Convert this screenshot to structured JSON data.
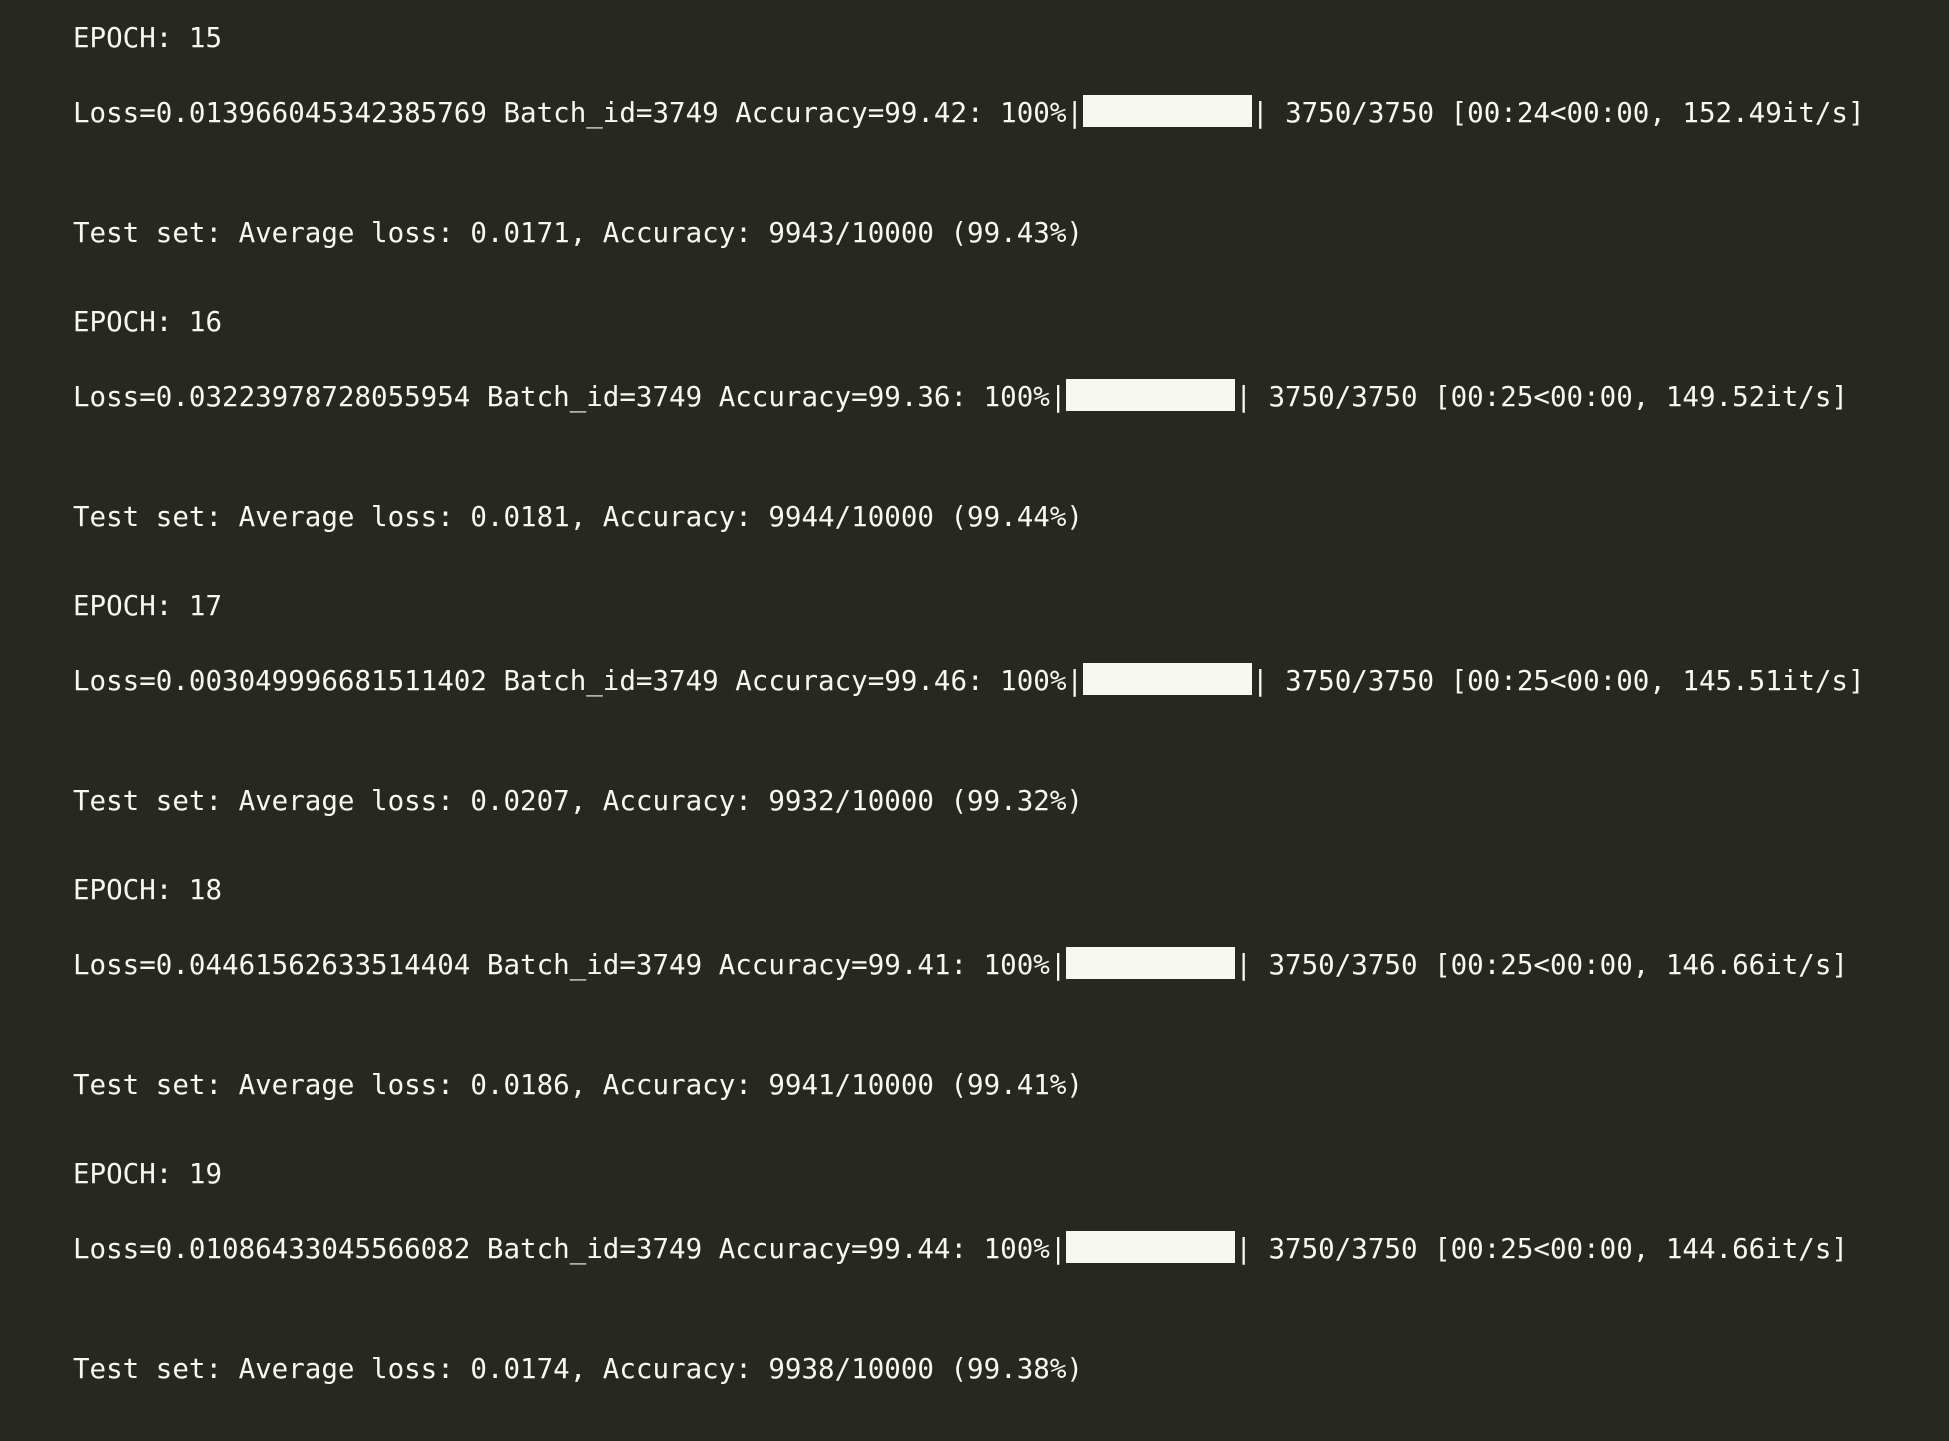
{
  "epochs": [
    {
      "epoch_label": "EPOCH: 15",
      "loss_text": "Loss=0.013966045342385769 Batch_id=3749 Accuracy=99.42: 100%|",
      "progress": 1.0,
      "progress_stats": "| 3750/3750 [00:24<00:00, 152.49it/s]",
      "test_summary": "Test set: Average loss: 0.0171, Accuracy: 9943/10000 (99.43%)"
    },
    {
      "epoch_label": "EPOCH: 16",
      "loss_text": "Loss=0.03223978728055954 Batch_id=3749 Accuracy=99.36: 100%|",
      "progress": 1.0,
      "progress_stats": "| 3750/3750 [00:25<00:00, 149.52it/s]",
      "test_summary": "Test set: Average loss: 0.0181, Accuracy: 9944/10000 (99.44%)"
    },
    {
      "epoch_label": "EPOCH: 17",
      "loss_text": "Loss=0.003049996681511402 Batch_id=3749 Accuracy=99.46: 100%|",
      "progress": 1.0,
      "progress_stats": "| 3750/3750 [00:25<00:00, 145.51it/s]",
      "test_summary": "Test set: Average loss: 0.0207, Accuracy: 9932/10000 (99.32%)"
    },
    {
      "epoch_label": "EPOCH: 18",
      "loss_text": "Loss=0.04461562633514404 Batch_id=3749 Accuracy=99.41: 100%|",
      "progress": 1.0,
      "progress_stats": "| 3750/3750 [00:25<00:00, 146.66it/s]",
      "test_summary": "Test set: Average loss: 0.0186, Accuracy: 9941/10000 (99.41%)"
    },
    {
      "epoch_label": "EPOCH: 19",
      "loss_text": "Loss=0.01086433045566082 Batch_id=3749 Accuracy=99.44: 100%|",
      "progress": 1.0,
      "progress_stats": "| 3750/3750 [00:25<00:00, 144.66it/s]",
      "test_summary": "Test set: Average loss: 0.0174, Accuracy: 9938/10000 (99.38%)"
    }
  ],
  "colors": {
    "background": "#272822",
    "text": "#f8f8f2",
    "progress_fill": "#f8f8f2"
  }
}
